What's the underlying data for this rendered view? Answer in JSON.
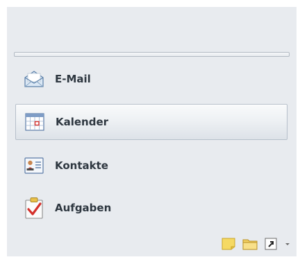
{
  "nav": {
    "items": [
      {
        "label": "E-Mail",
        "icon": "mail-icon",
        "selected": false
      },
      {
        "label": "Kalender",
        "icon": "calendar-icon",
        "selected": true
      },
      {
        "label": "Kontakte",
        "icon": "contacts-icon",
        "selected": false
      },
      {
        "label": "Aufgaben",
        "icon": "tasks-icon",
        "selected": false
      }
    ]
  },
  "footer": {
    "icons": [
      "notes-icon",
      "folder-icon",
      "shortcut-icon",
      "configure-buttons-icon"
    ]
  },
  "colors": {
    "pane_background": "#e8ebef",
    "selected_border": "#b6bfca",
    "label_text": "#2e3740"
  }
}
